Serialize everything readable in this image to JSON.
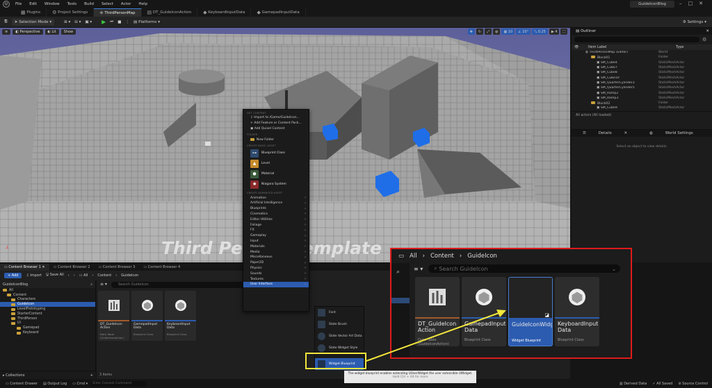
{
  "menubar": {
    "items": [
      "File",
      "Edit",
      "Window",
      "Tools",
      "Build",
      "Select",
      "Actor",
      "Help"
    ],
    "project_name": "GuideIconBlog"
  },
  "tabs": [
    {
      "label": "Plugins"
    },
    {
      "label": "Project Settings"
    },
    {
      "label": "ThirdPersonMap"
    },
    {
      "label": "DT_GuideIconAction"
    },
    {
      "label": "KeyboardInputData"
    },
    {
      "label": "GamepadInputData"
    }
  ],
  "toolbar": {
    "selection_mode": "Selection Mode",
    "platforms": "Platforms",
    "settings": "Settings"
  },
  "viewport": {
    "perspective": "Perspective",
    "lit": "Lit",
    "show": "Show",
    "grid_snap": "10",
    "rot_snap": "10°",
    "scale_snap": "0.25",
    "cam_speed": "4",
    "watermark": "Third Person Template"
  },
  "outliner": {
    "title": "Outliner",
    "col_label": "Item Label",
    "col_type": "Type",
    "rows": [
      {
        "label": "ThirdPersonMap (Editor)",
        "type": "World",
        "depth": 1
      },
      {
        "label": "Block01",
        "type": "Folder",
        "depth": 2
      },
      {
        "label": "SM_Cube4",
        "type": "StaticMeshActor",
        "depth": 3
      },
      {
        "label": "SM_Cube7",
        "type": "StaticMeshActor",
        "depth": 3
      },
      {
        "label": "SM_Cube8",
        "type": "StaticMeshActor",
        "depth": 3
      },
      {
        "label": "SM_Cube10",
        "type": "StaticMeshActor",
        "depth": 3
      },
      {
        "label": "SM_QuarterCylinder3",
        "type": "StaticMeshActor",
        "depth": 3
      },
      {
        "label": "SM_QuarterCylinder5",
        "type": "StaticMeshActor",
        "depth": 3
      },
      {
        "label": "SM_Ramp2",
        "type": "StaticMeshActor",
        "depth": 3
      },
      {
        "label": "SM_Ramp3",
        "type": "StaticMeshActor",
        "depth": 3
      },
      {
        "label": "Block02",
        "type": "Folder",
        "depth": 2
      },
      {
        "label": "SM_Cube9",
        "type": "StaticMeshActor",
        "depth": 3
      }
    ],
    "footer": "All actors (All loaded)"
  },
  "details": {
    "tab1": "Details",
    "tab2": "World Settings",
    "message": "Select an object to view details."
  },
  "content_browser": {
    "tabs": [
      "Content Browser 1",
      "Content Browser 2",
      "Content Browser 3",
      "Content Browser 4"
    ],
    "add": "Add",
    "import": "Import",
    "save_all": "Save All",
    "breadcrumb": [
      "All",
      "Content",
      "GuideIcon"
    ],
    "search_placeholder": "Search GuideIcon",
    "tree": [
      {
        "label": "GuideIconBlog",
        "depth": 0
      },
      {
        "label": "All",
        "depth": 0
      },
      {
        "label": "Content",
        "depth": 1
      },
      {
        "label": "Characters",
        "depth": 2
      },
      {
        "label": "GuideIcon",
        "depth": 2,
        "selected": true
      },
      {
        "label": "LevelPrototyping",
        "depth": 2
      },
      {
        "label": "StarterContent",
        "depth": 2
      },
      {
        "label": "ThirdPerson",
        "depth": 2
      },
      {
        "label": "UI",
        "depth": 2
      },
      {
        "label": "Gamepad",
        "depth": 3
      },
      {
        "label": "Keyboard",
        "depth": 3
      }
    ],
    "assets": [
      {
        "name": "DT_GuideIcon Action",
        "type": "Data Table (GuideIconAction)"
      },
      {
        "name": "GamepadInput Data",
        "type": "Blueprint Class"
      },
      {
        "name": "KeyboardInput Data",
        "type": "Blueprint Class"
      }
    ],
    "collections": "Collections",
    "item_count": "3 items"
  },
  "context_menu": {
    "sec_get": "GET CONTENT",
    "import": "Import to /Game/GuideIcon...",
    "add_feature": "Add Feature or Content Pack...",
    "add_quixel": "Add Quixel Content",
    "sec_folder": "FOLDER",
    "new_folder": "New Folder",
    "sec_basic": "CREATE BASIC ASSET",
    "basic": [
      "Blueprint Class",
      "Level",
      "Material",
      "Niagara System"
    ],
    "sec_adv": "CREATE ADVANCED ASSET",
    "advanced": [
      "Animation",
      "Artificial Intelligence",
      "Blueprints",
      "Cinematics",
      "Editor Utilities",
      "Foliage",
      "FX",
      "Gameplay",
      "Input",
      "Materials",
      "Media",
      "Miscellaneous",
      "Paper2D",
      "Physics",
      "Sounds",
      "Textures",
      "User Interface"
    ]
  },
  "submenu": {
    "items": [
      "Font",
      "Slate Brush",
      "Slate Vector Art Data",
      "Slate Widget Style",
      "Widget Blueprint"
    ]
  },
  "tooltip": {
    "line1": "The widget blueprint enables extending UUserWidget the user extensible UWidget.",
    "line2": "Hold Ctrl + Alt for more"
  },
  "statusbar": {
    "content_drawer": "Content Drawer",
    "output_log": "Output Log",
    "cmd": "Cmd",
    "cmd_placeholder": "Enter Console Command",
    "derived": "Derived Data",
    "all_saved": "All Saved",
    "source_control": "Source Control"
  },
  "zoom": {
    "breadcrumb": [
      "All",
      "Content",
      "GuideIcon"
    ],
    "search_placeholder": "Search GuideIcon",
    "assets": [
      {
        "name": "DT_GuideIcon Action",
        "type": "Data Table (GuideIconAction)"
      },
      {
        "name": "GamepadInput Data",
        "type": "Blueprint Class"
      },
      {
        "name": "GuideIconWidget",
        "type": "Widget Blueprint"
      },
      {
        "name": "KeyboardInput Data",
        "type": "Blueprint Class"
      }
    ]
  },
  "colors": {
    "accent": "#2c5cb0",
    "highlight_yellow": "#f2e63c",
    "zoom_border": "#e01a1a"
  }
}
